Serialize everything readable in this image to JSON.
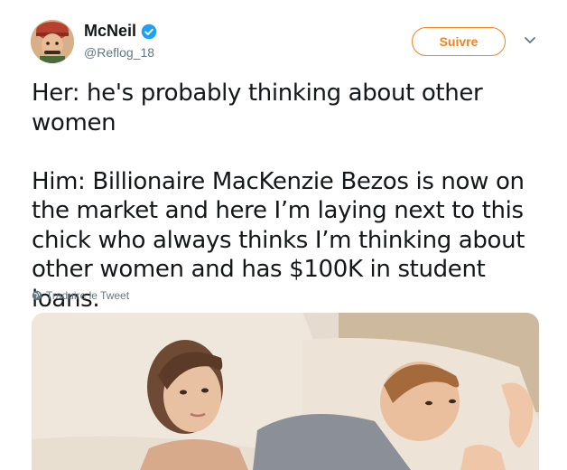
{
  "tweet": {
    "author": {
      "display_name": "McNeil",
      "handle": "@Reflog_18",
      "verified_icon": "verified-badge-icon",
      "avatar_icon": "user-avatar"
    },
    "follow_label": "Suivre",
    "text_lines_1": [
      "Her: he's probably thinking about other",
      "women"
    ],
    "text_lines_2": [
      "Him: Billionaire MacKenzie Bezos is now on",
      "the market and here I’m laying next to this",
      "chick who always thinks I’m thinking about",
      "other women and has $100K in student loans."
    ],
    "translate_label": "Traduire le Tweet",
    "media_icon": "photo-couple-in-bed"
  },
  "colors": {
    "accent": "#f5811f",
    "verified": "#1da1f2",
    "secondary_text": "#657786",
    "primary_text": "#14171a"
  }
}
